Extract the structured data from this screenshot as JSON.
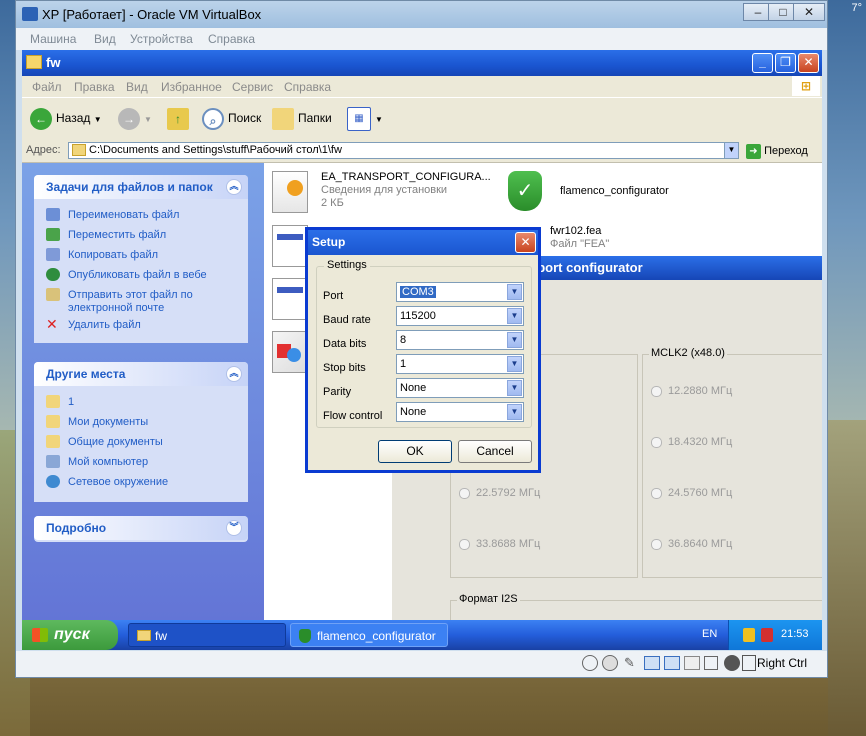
{
  "host": {
    "clock": "7°"
  },
  "vbox": {
    "title": "XP [Работает] - Oracle VM VirtualBox",
    "menu": [
      "Машина",
      "Вид",
      "Устройства",
      "Справка"
    ],
    "host_key": "Right Ctrl"
  },
  "explorer": {
    "title": "fw",
    "menu": [
      "Файл",
      "Правка",
      "Вид",
      "Избранное",
      "Сервис",
      "Справка"
    ],
    "toolbar": {
      "back": "Назад",
      "search": "Поиск",
      "folders": "Папки"
    },
    "address_label": "Адрес:",
    "address_value": "C:\\Documents and Settings\\stuff\\Рабочий стол\\1\\fw",
    "go_label": "Переход",
    "tasks": {
      "title": "Задачи для файлов и папок",
      "items": [
        "Переименовать файл",
        "Переместить файл",
        "Копировать файл",
        "Опубликовать файл в вебе",
        "Отправить этот файл по электронной почте",
        "Удалить файл"
      ]
    },
    "places": {
      "title": "Другие места",
      "items": [
        "1",
        "Мои документы",
        "Общие документы",
        "Мой компьютер",
        "Сетевое окружение"
      ]
    },
    "details": {
      "title": "Подробно"
    },
    "files": [
      {
        "name": "EA_TRANSPORT_CONFIGURA...",
        "type": "Сведения для установки",
        "size": "2 КБ"
      },
      {
        "name": "flamenco_configurator"
      },
      {
        "name": "fwr102.fea",
        "type": "Файл \"FEA\"",
        "size": ""
      }
    ]
  },
  "flamenco": {
    "title_visible": "sport configurator",
    "group2_title": "MCLK2 (x48.0)",
    "freqs_col1": [
      "22.5792 МГц",
      "33.8688 МГц"
    ],
    "freqs_col2": [
      "12.2880 МГц",
      "18.4320 МГц",
      "24.5760 МГц",
      "36.8640 МГц"
    ],
    "format_label": "Формат I2S"
  },
  "setup": {
    "title": "Setup",
    "legend": "Settings",
    "rows": [
      {
        "label": "Port",
        "value": "COM3"
      },
      {
        "label": "Baud rate",
        "value": "115200"
      },
      {
        "label": "Data bits",
        "value": "8"
      },
      {
        "label": "Stop bits",
        "value": "1"
      },
      {
        "label": "Parity",
        "value": "None"
      },
      {
        "label": "Flow control",
        "value": "None"
      }
    ],
    "ok": "OK",
    "cancel": "Cancel"
  },
  "taskbar": {
    "start": "пуск",
    "tasks": [
      "fw",
      "flamenco_configurator"
    ],
    "lang": "EN",
    "time": "21:53"
  }
}
